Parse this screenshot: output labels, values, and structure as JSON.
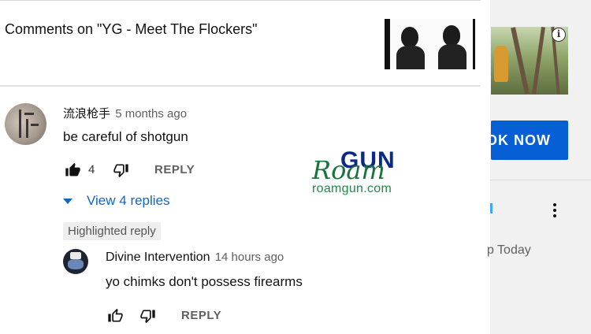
{
  "header": {
    "title": "Comments on \"YG - Meet The Flockers\""
  },
  "comments": [
    {
      "author": "流浪枪手",
      "time": "5 months ago",
      "text": "be careful of shotgun",
      "likes": "4",
      "reply_label": "REPLY",
      "like_icon": "thumb-up-filled-icon",
      "dislike_icon": "thumb-down-outline-icon"
    }
  ],
  "replies": {
    "view_label": "View 4 replies",
    "highlight_label": "Highlighted reply",
    "reply": {
      "author": "Divine Intervention",
      "time": "14 hours ago",
      "text": "yo chimks don't possess firearms",
      "reply_label": "REPLY",
      "like_icon": "thumb-up-outline-icon",
      "dislike_icon": "thumb-down-outline-icon"
    }
  },
  "watermark": {
    "gun": "GUN",
    "roam": "Roam",
    "url": "roamgun.com"
  },
  "sidebar": {
    "cta_label": "OK NOW",
    "partial_text": "p Today",
    "info_icon": "info-icon",
    "more_icon": "more-vertical-icon"
  },
  "colors": {
    "accent_blue": "#065fd4",
    "link_blue": "#1565c0",
    "watermark_green": "#17743b",
    "watermark_navy": "#0b2a86"
  }
}
